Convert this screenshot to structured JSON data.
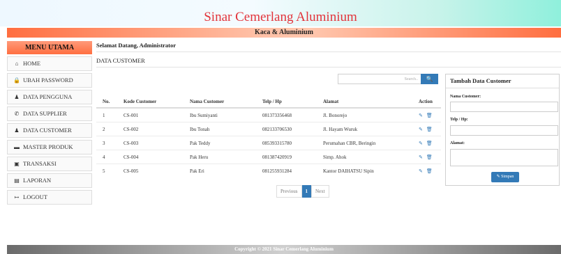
{
  "header": {
    "title": "Sinar Cemerlang Aluminium",
    "subtitle": "Kaca & Aluminium"
  },
  "sidebar": {
    "heading": "MENU UTAMA",
    "items": [
      {
        "label": "HOME",
        "icon": "home-icon",
        "glyph": "⌂"
      },
      {
        "label": "UBAH PASSWORD",
        "icon": "lock-icon",
        "glyph": "🔒"
      },
      {
        "label": "DATA PENGGUNA",
        "icon": "user-icon",
        "glyph": "♟"
      },
      {
        "label": "DATA SUPPLIER",
        "icon": "phone-icon",
        "glyph": "✆"
      },
      {
        "label": "DATA CUSTOMER",
        "icon": "users-icon",
        "glyph": "♟"
      },
      {
        "label": "MASTER PRODUK",
        "icon": "folder-icon",
        "glyph": "▬"
      },
      {
        "label": "TRANSAKSI",
        "icon": "transaction-icon",
        "glyph": "▣"
      },
      {
        "label": "LAPORAN",
        "icon": "file-icon",
        "glyph": "▤"
      },
      {
        "label": "LOGOUT",
        "icon": "logout-icon",
        "glyph": "↦"
      }
    ]
  },
  "welcome": "Selamat Datang, Administrator",
  "page_title": "DATA CUSTOMER",
  "search": {
    "placeholder": "Search..",
    "icon": "search-icon"
  },
  "table": {
    "headers": [
      "No.",
      "Kode Customer",
      "Nama Customer",
      "Telp / Hp",
      "Alamat",
      "Action"
    ],
    "rows": [
      [
        "1",
        "CS-001",
        "Ibu Sumiyanti",
        "081373356468",
        "Jl. Bonorejo"
      ],
      [
        "2",
        "CS-002",
        "Ibu Tonah",
        "082133706530",
        "Jl. Hayam Wuruk"
      ],
      [
        "3",
        "CS-003",
        "Pak Teddy",
        "085393315780",
        "Perumahan CBR, Beringin"
      ],
      [
        "4",
        "CS-004",
        "Pak Heru",
        "081387420919",
        "Simp. Ahok"
      ],
      [
        "5",
        "CS-005",
        "Pak Eri",
        "081255931284",
        "Kantor DAIHATSU Sipin"
      ]
    ]
  },
  "pagination": {
    "previous": "Previous",
    "current": "1",
    "next": "Next"
  },
  "form": {
    "title": "Tambah Data Customer",
    "name_label": "Nama Customer:",
    "phone_label": "Telp / Hp:",
    "address_label": "Alamat:",
    "save_label": "Simpan"
  },
  "footer": "Copyright © 2021 Sinar Cemerlang Aluminium",
  "colors": {
    "title_red": "#e2333a",
    "accent_orange": "#ff6e40",
    "primary_blue": "#337ab7"
  }
}
